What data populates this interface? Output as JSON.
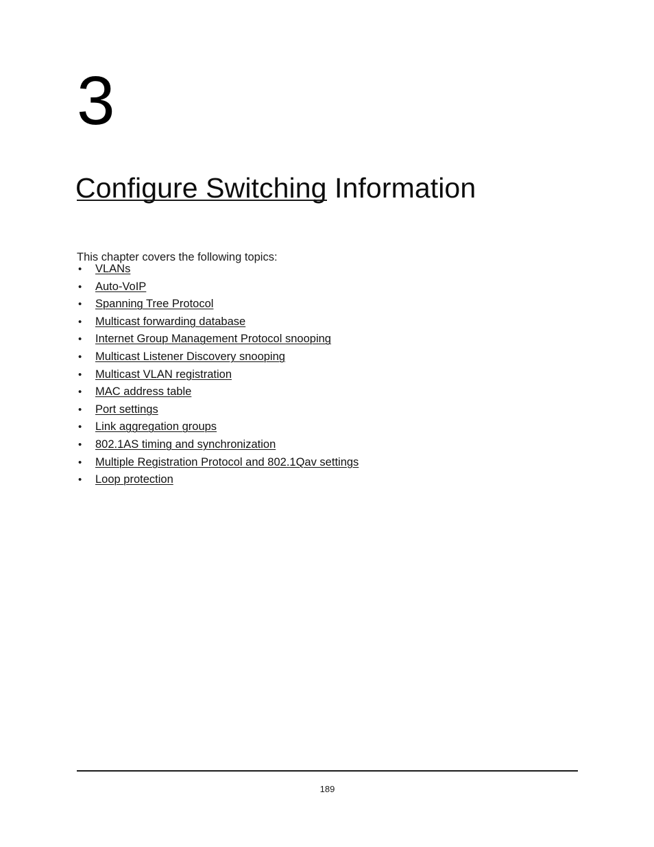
{
  "document": {
    "chapter_number": "3",
    "chapter_title": "Configure Switching Information",
    "intro_text": "This chapter covers the following topics:",
    "bullet_glyph": "•",
    "topics": [
      {
        "label": "VLANs"
      },
      {
        "label": "Auto-VoIP"
      },
      {
        "label": "Spanning Tree Protocol"
      },
      {
        "label": "Multicast forwarding database"
      },
      {
        "label": "Internet Group Management Protocol snooping"
      },
      {
        "label": "Multicast Listener Discovery snooping"
      },
      {
        "label": "Multicast VLAN registration"
      },
      {
        "label": "MAC address table"
      },
      {
        "label": "Port settings"
      },
      {
        "label": "Link aggregation groups"
      },
      {
        "label": "802.1AS timing and synchronization"
      },
      {
        "label": "Multiple Registration Protocol and 802.1Qav settings"
      },
      {
        "label": "Loop protection"
      }
    ],
    "footer": {
      "page_number": "189"
    },
    "colors": {
      "background": "#ffffff",
      "text": "#1a1a1a",
      "rule": "#1a1a1a",
      "link": "#111111"
    }
  }
}
